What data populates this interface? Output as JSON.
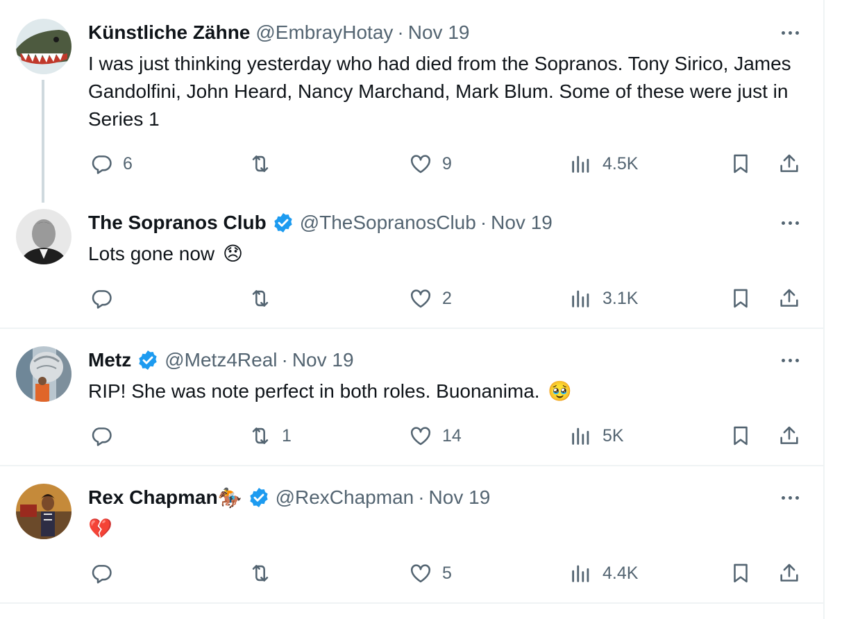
{
  "tweets": [
    {
      "name": "Künstliche Zähne",
      "handle": "@EmbrayHotay",
      "separator": "·",
      "date": "Nov 19",
      "text": "I was just thinking yesterday who had died from the Sopranos. Tony Sirico, James Gandolfini, John Heard, Nancy Marchand, Mark Blum. Some of these were just in Series 1",
      "replies": "6",
      "retweets": "",
      "likes": "9",
      "views": "4.5K"
    },
    {
      "name": "The Sopranos Club",
      "handle": "@TheSopranosClub",
      "separator": "·",
      "date": "Nov 19",
      "text": "Lots gone now",
      "text_emoji": "😞",
      "replies": "",
      "retweets": "",
      "likes": "2",
      "views": "3.1K"
    },
    {
      "name": "Metz",
      "handle": "@Metz4Real",
      "separator": "·",
      "date": "Nov 19",
      "text": "RIP! She was note perfect in both roles. Buonanima.",
      "text_emoji": "🥹",
      "replies": "",
      "retweets": "1",
      "likes": "14",
      "views": "5K"
    },
    {
      "name": "Rex Chapman",
      "name_emoji": "🏇",
      "handle": "@RexChapman",
      "separator": "·",
      "date": "Nov 19",
      "text": "",
      "text_emoji": "💔",
      "replies": "",
      "retweets": "",
      "likes": "5",
      "views": "4.4K"
    }
  ],
  "colors": {
    "text": "#0f1419",
    "muted": "#536471",
    "verified": "#1d9bf0",
    "border": "#eff3f4",
    "thread_line": "#cfd9de"
  },
  "icons": [
    "reply-icon",
    "retweet-icon",
    "like-icon",
    "views-icon",
    "bookmark-icon",
    "share-icon",
    "more-icon",
    "verified-badge-icon"
  ]
}
